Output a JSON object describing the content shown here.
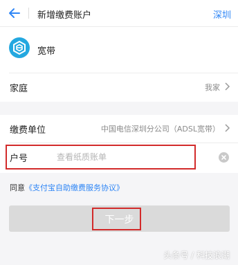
{
  "header": {
    "title": "新增缴费账户",
    "city": "深圳"
  },
  "account": {
    "type_label": "宽带",
    "icon": "broadband-icon"
  },
  "family": {
    "label": "家庭",
    "value": "我家"
  },
  "unit": {
    "label": "缴费单位",
    "value": "中国电信深圳分公司（ADSL宽带）"
  },
  "account_number": {
    "label": "户号",
    "placeholder": "查看纸质账单"
  },
  "agreement": {
    "prefix": "同意",
    "link": "《支付宝自助缴费服务协议》"
  },
  "next": {
    "label": "下一步"
  },
  "watermark": "头条号 / 科技浪潮",
  "colors": {
    "accent": "#2f86f6",
    "logo": "#24a8e0",
    "highlight": "#d22a2a"
  }
}
